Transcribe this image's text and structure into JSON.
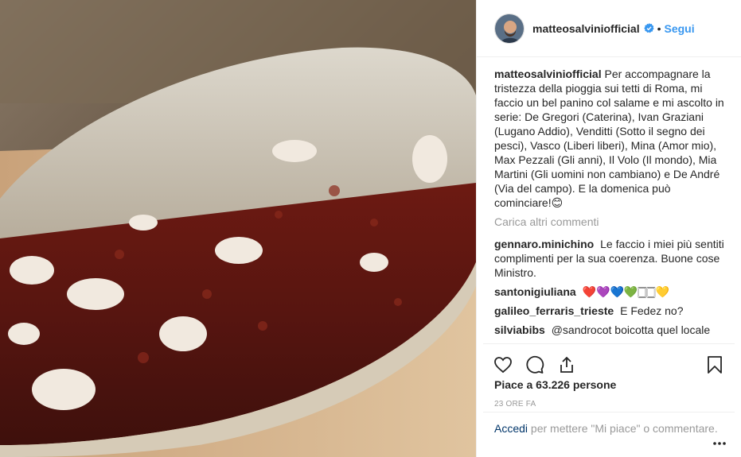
{
  "post": {
    "username": "matteosalviniofficial",
    "follow_label": "Segui",
    "separator": "•",
    "caption_user": "matteosalviniofficial",
    "caption_text": "Per accompagnare la tristezza della pioggia sui tetti di Roma, mi faccio un bel panino col salame e mi ascolto in serie: De Gregori (Caterina), Ivan Graziani (Lugano Addio), Venditti (Sotto il segno dei pesci), Vasco (Liberi liberi), Mina (Amor mio), Max Pezzali (Gli anni), Il Volo (Il mondo), Mia Martini (Gli uomini non cambiano) e De André (Via del campo). E la domenica può cominciare!😊",
    "load_more": "Carica altri commenti",
    "comments": [
      {
        "user": "gennaro.minichino",
        "text": "Le faccio i miei più sentiti complimenti per la sua coerenza. Buone cose Ministro."
      },
      {
        "user": "santonigiuliana",
        "text": "❤️💜💙💚🀆🀆💛"
      },
      {
        "user": "galileo_ferraris_trieste",
        "text": "E Fedez no?"
      },
      {
        "user": "silviabibs",
        "text": "@sandrocot boicotta quel locale"
      }
    ],
    "likes": "Piace a 63.226 persone",
    "time": "23 ORE FA",
    "login_link": "Accedi",
    "login_text": " per mettere \"Mi piace\" o commentare."
  },
  "icons": {
    "like": "heart-icon",
    "comment": "comment-icon",
    "share": "share-icon",
    "save": "bookmark-icon",
    "more": "more-dots-icon",
    "verified": "verified-badge-icon"
  },
  "colors": {
    "link": "#3897f0",
    "muted": "#999999",
    "dark_link": "#003569",
    "verified": "#3897f0"
  }
}
